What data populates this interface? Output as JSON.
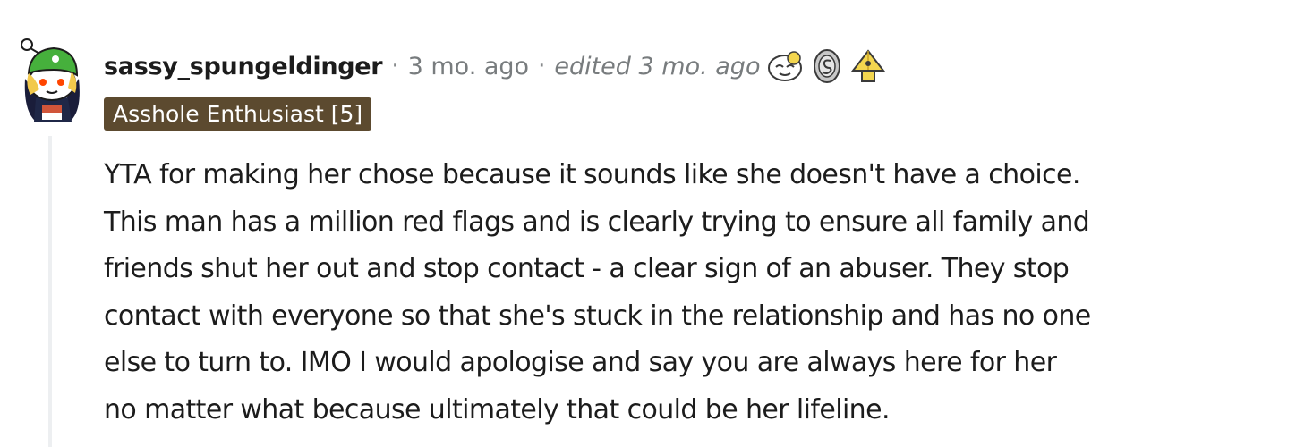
{
  "comment": {
    "username": "sassy_spungeldinger",
    "separator": "·",
    "time": "3 mo. ago",
    "edited": "edited 3 mo. ago",
    "flair": "Asshole Enthusiast [5]",
    "awards": [
      "wholesome-face-award-icon",
      "silver-coin-award-icon",
      "gold-pyramid-award-icon"
    ],
    "body_lines": [
      "YTA for making her chose because it sounds like she doesn't have a choice.",
      "This man has a million red flags and is clearly trying to ensure all family and",
      "friends shut her out and stop contact - a clear sign of an abuser. They stop",
      "contact with everyone so that she's stuck in the relationship and has no one",
      "else to turn to. IMO I would apologise and say you are always here for her",
      "no matter what because ultimately that could be her lifeline."
    ]
  },
  "colors": {
    "flair_background": "#5c4a2f",
    "flair_text": "#ffffff",
    "meta_text": "#787c7e",
    "thread_line": "#edeff1",
    "avatar_helmet": "#46b03c"
  }
}
